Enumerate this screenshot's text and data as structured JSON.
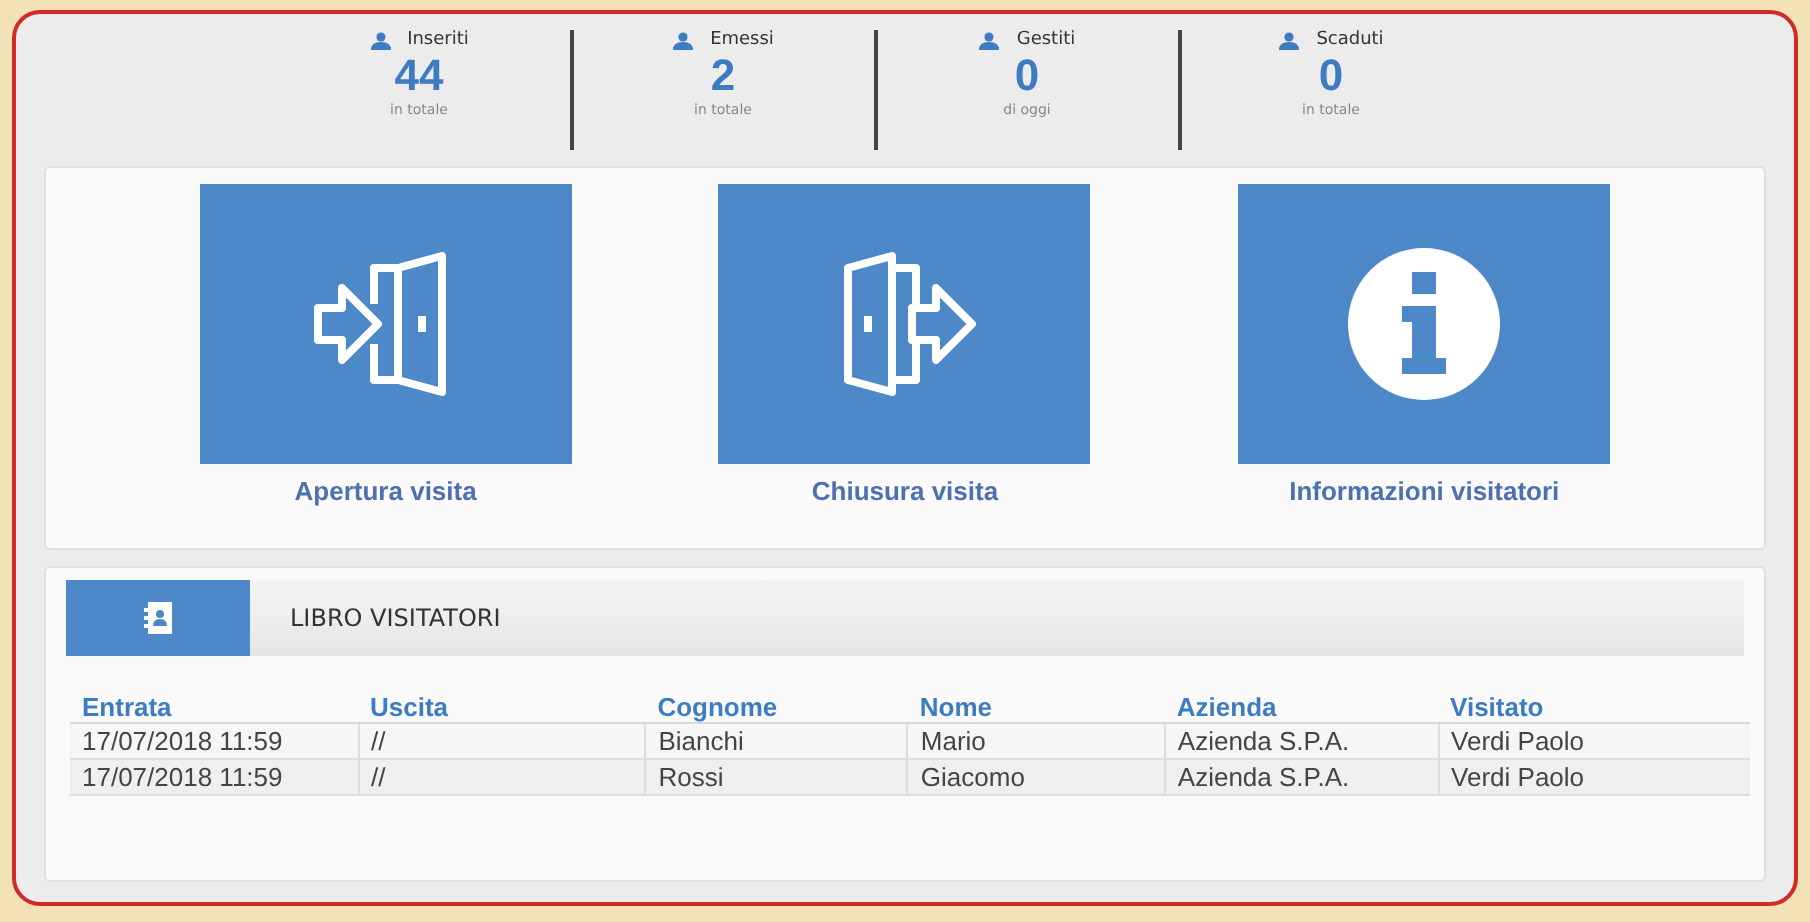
{
  "stats": [
    {
      "label": "Inseriti",
      "value": "44",
      "caption": "in totale"
    },
    {
      "label": "Emessi",
      "value": "2",
      "caption": "in totale"
    },
    {
      "label": "Gestiti",
      "value": "0",
      "caption": "di oggi"
    },
    {
      "label": "Scaduti",
      "value": "0",
      "caption": "in totale"
    }
  ],
  "actions": [
    {
      "kind": "entry",
      "label": "Apertura visita"
    },
    {
      "kind": "exit",
      "label": "Chiusura visita"
    },
    {
      "kind": "info",
      "label": "Informazioni visitatori"
    }
  ],
  "visitor_book": {
    "title": "LIBRO VISITATORI",
    "columns": [
      "Entrata",
      "Uscita",
      "Cognome",
      "Nome",
      "Azienda",
      "Visitato"
    ],
    "rows": [
      [
        "17/07/2018 11:59",
        "//",
        "Bianchi",
        "Mario",
        "Azienda S.P.A.",
        "Verdi Paolo"
      ],
      [
        "17/07/2018 11:59",
        "//",
        "Rossi",
        "Giacomo",
        "Azienda S.P.A.",
        "Verdi Paolo"
      ]
    ]
  }
}
